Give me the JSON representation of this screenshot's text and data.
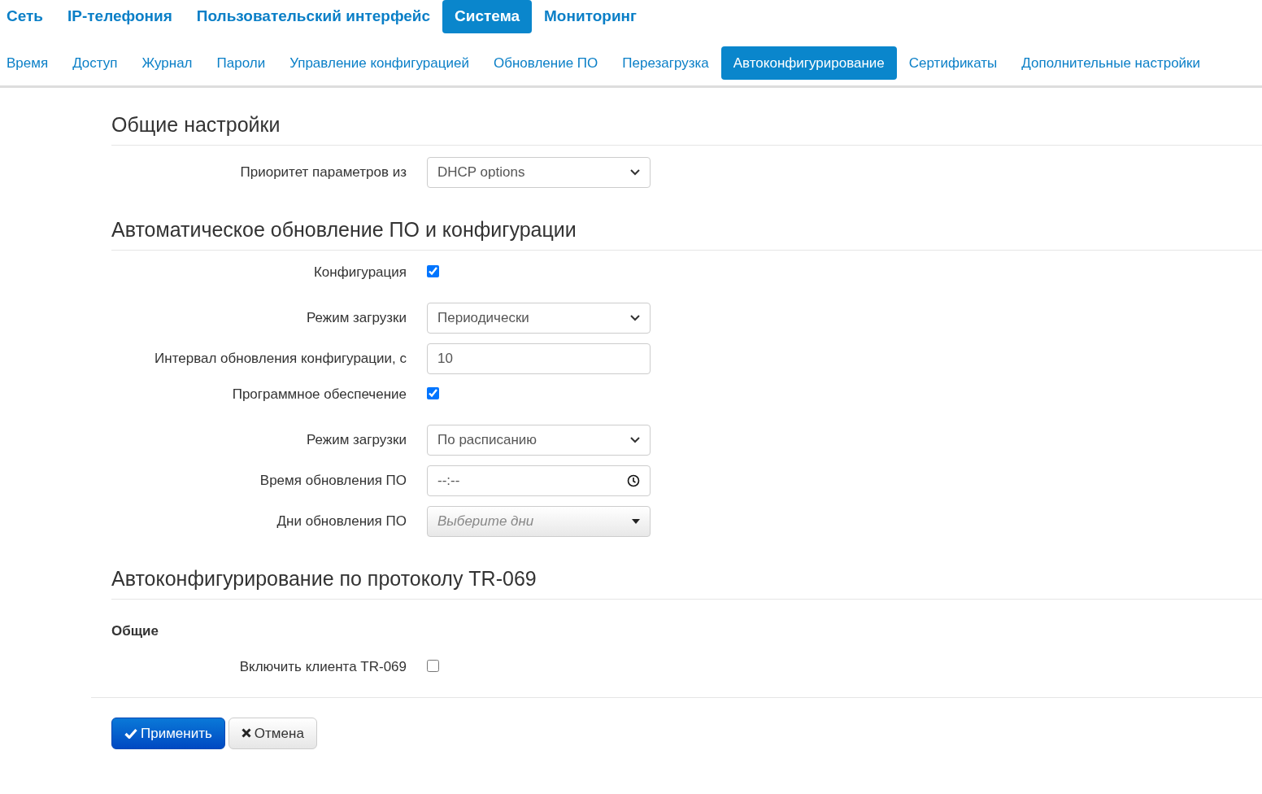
{
  "main_tabs": [
    {
      "label": "Сеть",
      "selected": false
    },
    {
      "label": "IP-телефония",
      "selected": false
    },
    {
      "label": "Пользовательский интерфейс",
      "selected": false
    },
    {
      "label": "Система",
      "selected": true
    },
    {
      "label": "Мониторинг",
      "selected": false
    }
  ],
  "sub_tabs": [
    {
      "label": "Время",
      "selected": false
    },
    {
      "label": "Доступ",
      "selected": false
    },
    {
      "label": "Журнал",
      "selected": false
    },
    {
      "label": "Пароли",
      "selected": false
    },
    {
      "label": "Управление конфигурацией",
      "selected": false
    },
    {
      "label": "Обновление ПО",
      "selected": false
    },
    {
      "label": "Перезагрузка",
      "selected": false
    },
    {
      "label": "Автоконфигурирование",
      "selected": true
    },
    {
      "label": "Сертификаты",
      "selected": false
    },
    {
      "label": "Дополнительные настройки",
      "selected": false
    }
  ],
  "sections": [
    {
      "title": "Общие настройки",
      "fields": [
        {
          "kind": "select",
          "label": "Приоритет параметров из",
          "value": "DHCP options"
        }
      ]
    },
    {
      "title": "Автоматическое обновление ПО и конфигурации",
      "fields": [
        {
          "kind": "checkbox",
          "label": "Конфигурация",
          "checked": true
        },
        {
          "kind": "select",
          "label": "Режим загрузки",
          "value": "Периодически"
        },
        {
          "kind": "text",
          "label": "Интервал обновления конфигурации, с",
          "value": "10"
        },
        {
          "kind": "checkbox",
          "label": "Программное обеспечение",
          "checked": true
        },
        {
          "kind": "select",
          "label": "Режим загрузки",
          "value": "По расписанию"
        },
        {
          "kind": "time",
          "label": "Время обновления ПО",
          "value": "--:--"
        },
        {
          "kind": "multiselect",
          "label": "Дни обновления ПО",
          "placeholder": "Выберите дни"
        }
      ]
    },
    {
      "title": "Автоконфигурирование по протоколу TR-069",
      "subtitle": "Общие",
      "fields": [
        {
          "kind": "checkbox",
          "label": "Включить клиента TR-069",
          "checked": false
        }
      ]
    }
  ],
  "buttons": [
    {
      "kind": "apply",
      "label": "Применить"
    },
    {
      "kind": "cancel",
      "label": "Отмена"
    }
  ]
}
